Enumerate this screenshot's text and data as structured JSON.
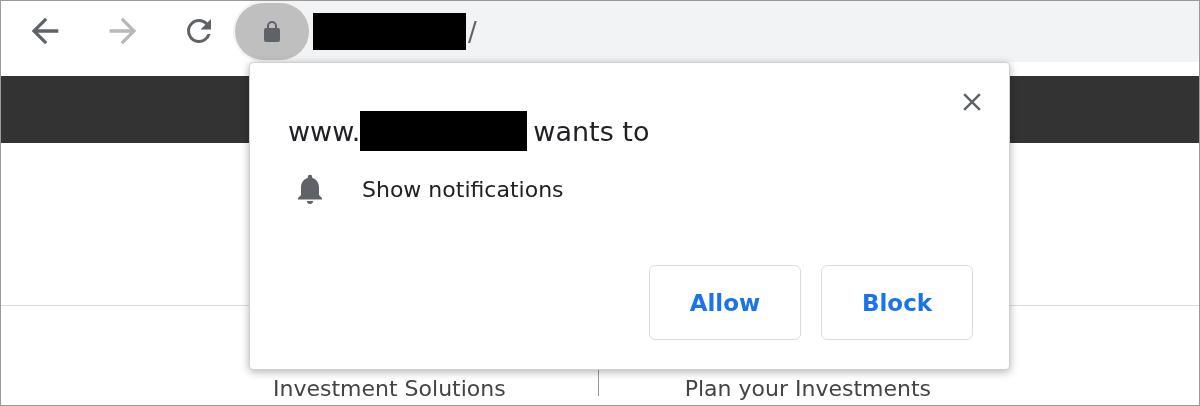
{
  "toolbar": {
    "back_disabled": false,
    "forward_disabled": true,
    "address_text": "/"
  },
  "page": {
    "nav_items": [
      "Investment Solutions",
      "Plan your Investments"
    ]
  },
  "permission_popup": {
    "title_prefix": "www.",
    "title_suffix": "wants to",
    "permissions": [
      {
        "kind": "notifications",
        "label": "Show notifications"
      }
    ],
    "buttons": [
      "Allow",
      "Block"
    ]
  }
}
